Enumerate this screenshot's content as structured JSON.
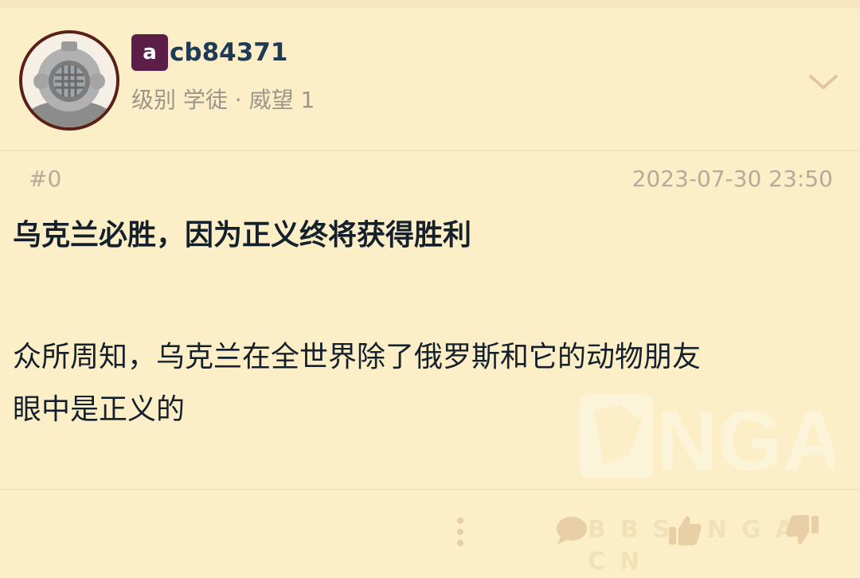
{
  "post": {
    "author": {
      "badge_letter": "a",
      "username": "cb84371",
      "level_text": "级别 学徒 · 威望 1"
    },
    "floor": "#0",
    "timestamp": "2023-07-30 23:50",
    "title": "乌克兰必胜，因为正义终将获得胜利",
    "body_lines": [
      "众所周知，乌克兰在全世界除了俄罗斯和它的动物朋友",
      "眼中是正义的"
    ]
  },
  "watermark": {
    "logo_text": "NGA",
    "footer_text": "BBS NGA CN"
  },
  "icons": {
    "avatar": "diving-helmet-avatar",
    "expand": "chevron-down-icon",
    "more": "more-vertical-icon",
    "comment": "comment-icon",
    "like": "thumbs-up-icon",
    "dislike": "thumbs-down-icon"
  },
  "colors": {
    "background": "#fcefc8",
    "badge": "#5c1e49",
    "username": "#1f3a55",
    "muted": "#b5ab98",
    "icon": "#e8cfa5"
  }
}
